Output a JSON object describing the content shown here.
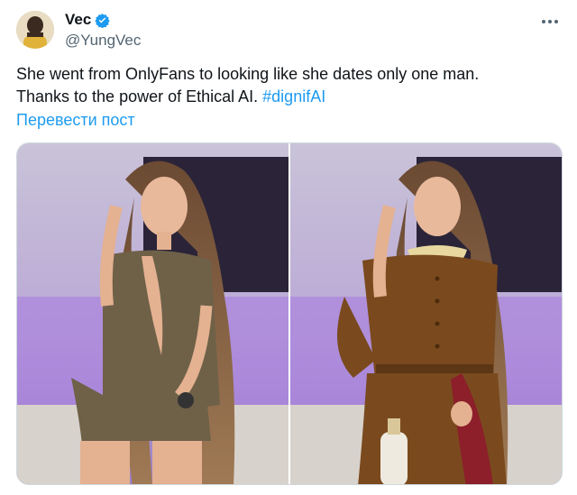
{
  "author": {
    "display_name": "Vec",
    "handle": "@YungVec",
    "verified": true
  },
  "more_icon": "more-horizontal-icon",
  "tweet": {
    "line1": "She went from OnlyFans to looking like she dates only one man.",
    "line2_text": "Thanks to the power of Ethical AI. ",
    "hashtag": "#dignifAI",
    "translate_label": "Перевести пост"
  },
  "media": {
    "count": 2
  },
  "colors": {
    "accent": "#1d9bf0",
    "text": "#0f1419",
    "secondary": "#536471"
  }
}
